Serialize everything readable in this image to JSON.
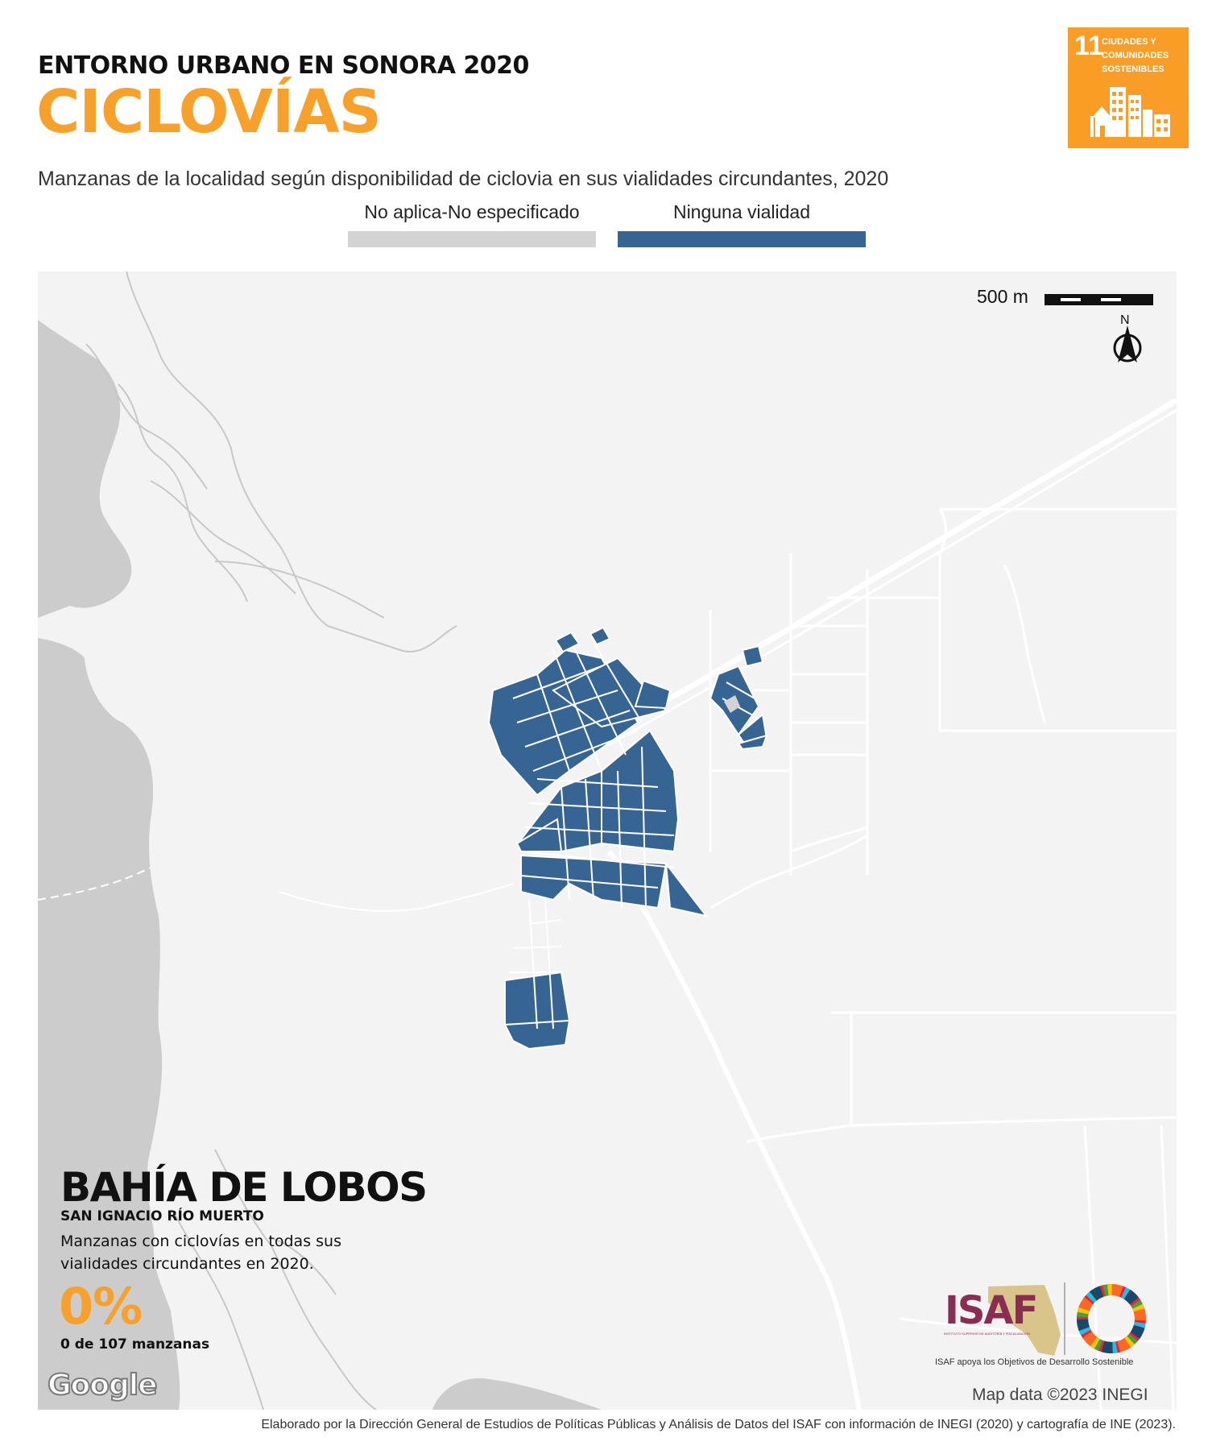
{
  "header": {
    "supertitle": "ENTORNO URBANO EN SONORA 2020",
    "title": "CICLOVÍAS",
    "subtitle": "Manzanas de la localidad según disponibilidad de ciclovia en sus vialidades circundantes, 2020"
  },
  "sdg_badge": {
    "number": "11",
    "text": "CIUDADES Y COMUNIDADES SOSTENIBLES",
    "color": "#f99d26",
    "icon": "city-buildings-icon"
  },
  "legend": [
    {
      "label": "No aplica-No especificado",
      "color": "#d3d3d3"
    },
    {
      "label": "Ninguna vialidad",
      "color": "#376593"
    }
  ],
  "map": {
    "scale_label": "500 m",
    "north_label": "N",
    "water_color": "#cccccc",
    "land_color": "#f3f3f3",
    "road_color": "#ffffff",
    "block_color": "#376593",
    "na_block_color": "#d3d3d3",
    "google_label": "Google",
    "attribution": "Map data ©2023 INEGI"
  },
  "locality": {
    "name": "BAHÍA DE LOBOS",
    "municipality": "SAN IGNACIO RÍO MUERTO",
    "stat_description": "Manzanas con ciclovías en todas sus vialidades circundantes en 2020.",
    "stat_value": "0%",
    "stat_count": "0 de 107 manzanas"
  },
  "logos": {
    "isaf": "ISAF",
    "isaf_subtext": "INSTITUTO SUPERIOR DE AUDITORÍA Y FISCALIZACIÓN",
    "isaf_tagline": "ISAF apoya los Objetivos de Desarrollo Sostenible",
    "isaf_color": "#8b2d52"
  },
  "footer": "Elaborado por la Dirección General de Estudios de Políticas Públicas y Análisis de Datos del ISAF con información de INEGI (2020) y cartografía de INE (2023)."
}
